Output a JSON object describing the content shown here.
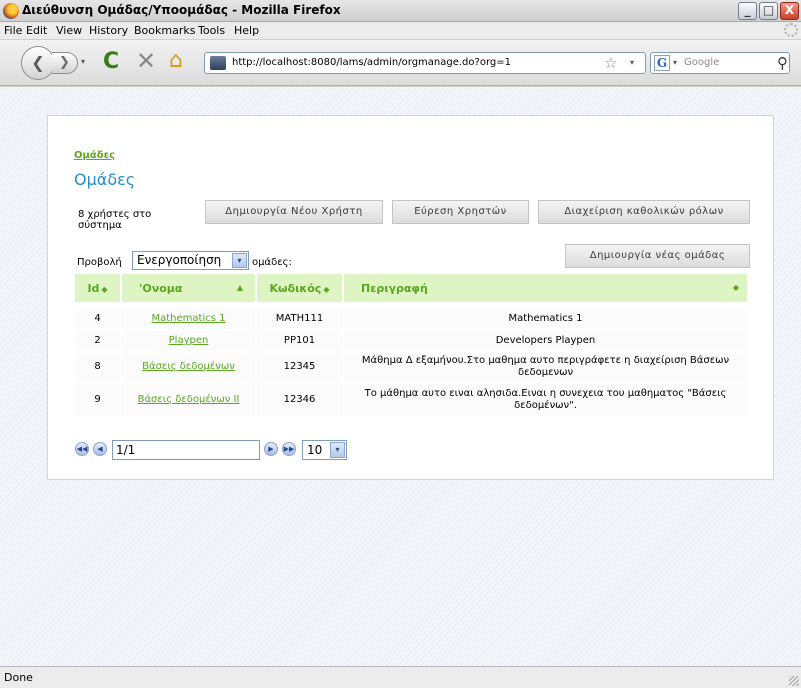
{
  "window": {
    "title": "Διεύθυνση Ομάδας/Υποομάδας - Mozilla Firefox",
    "min": "_",
    "max": "□",
    "close": "X"
  },
  "menu": {
    "file": "File",
    "edit": "Edit",
    "view": "View",
    "history": "History",
    "bookmarks": "Bookmarks",
    "tools": "Tools",
    "help": "Help"
  },
  "toolbar": {
    "url": "http://localhost:8080/lams/admin/orgmanage.do?org=1",
    "search_placeholder": "Google",
    "search_engine": "G"
  },
  "icons": {
    "back": "❮",
    "forward": "❯",
    "dropdown": "▾",
    "reload": "C",
    "stop": "✕",
    "home": "⌂",
    "star": "☆",
    "magnifier": "⚲"
  },
  "page": {
    "breadcrumb": "Ομάδες",
    "heading": "Ομάδες",
    "user_count": "8 χρήστες στο σύστημα",
    "buttons": {
      "new_user": "Δημιουργία Νέου Χρήστη",
      "find_users": "Εύρεση Χρηστών",
      "global_roles": "Διαχείριση καθολικών ρόλων",
      "new_group": "Δημιουργία νέας ομάδας"
    },
    "filter": {
      "prefix": "Προβολή",
      "selected": "Ενεργοποίηση",
      "suffix": "ομάδες:"
    },
    "table": {
      "headers": {
        "id": "Id",
        "name": "'Ονομα",
        "code": "Κωδικός",
        "description": "Περιγραφή"
      },
      "sort_icons": {
        "both": "◆",
        "asc": "▲"
      },
      "rows": [
        {
          "id": "4",
          "name": "Mathematics 1",
          "code": "MATH111",
          "description": "Mathematics 1"
        },
        {
          "id": "2",
          "name": "Playpen",
          "code": "PP101",
          "description": "Developers Playpen"
        },
        {
          "id": "8",
          "name": "Βάσεις δεδομένων",
          "code": "12345",
          "description": "Μάθημα Δ εξαμήνου.Στο μαθημα αυτο περιγράφετε η διαχείριση Βάσεων δεδομενων"
        },
        {
          "id": "9",
          "name": "Βάσεις δεδομένων ΙΙ",
          "code": "12346",
          "description": "Το μάθημα αυτο ειναι αλησιδα.Ειναι η συνεχεια του μαθηματος \"Βάσεις δεδομένων\"."
        }
      ]
    },
    "pager": {
      "page": "1/1",
      "page_size": "10",
      "first": "◀◀",
      "prev": "◀",
      "next": "▶",
      "last": "▶▶"
    }
  },
  "status": {
    "text": "Done"
  },
  "colors": {
    "accent_green": "#5aa61f",
    "heading_blue": "#2a8cc8",
    "table_header_bg": "#def4c2"
  }
}
